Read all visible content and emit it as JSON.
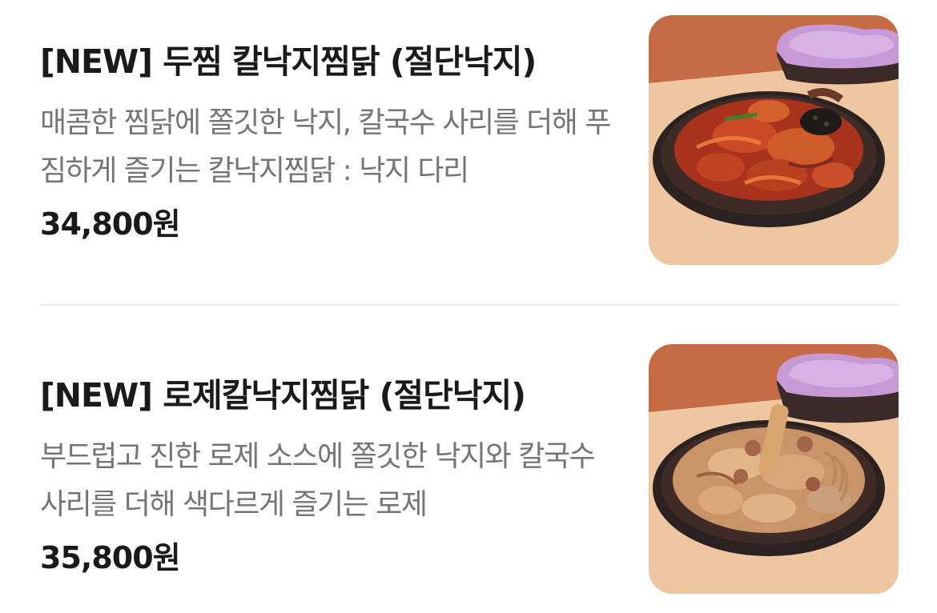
{
  "items": [
    {
      "title": "[NEW] 두찜 칼낙지찜닭 (절단낙지)",
      "description": "매콤한 찜닭에 쫄깃한 낙지, 칼국수 사리를 더해 푸짐하게 즐기는 칼낙지찜닭 : 낙지 다리",
      "price": "34,800원",
      "image_icon": "spicy-chicken-dish-image"
    },
    {
      "title": "[NEW] 로제칼낙지찜닭 (절단낙지)",
      "description": "부드럽고 진한 로제 소스에 쫄깃한 낙지와 칼국수 사리를 더해 색다르게 즐기는 로제",
      "price": "35,800원",
      "image_icon": "rose-chicken-dish-image"
    }
  ],
  "colors": {
    "title": "#1a1a1a",
    "description": "#757575",
    "divider": "#ececec",
    "image_background": "#c56c45",
    "table_surface": "#f0c8a0",
    "container_lid": "#c79ad6"
  }
}
